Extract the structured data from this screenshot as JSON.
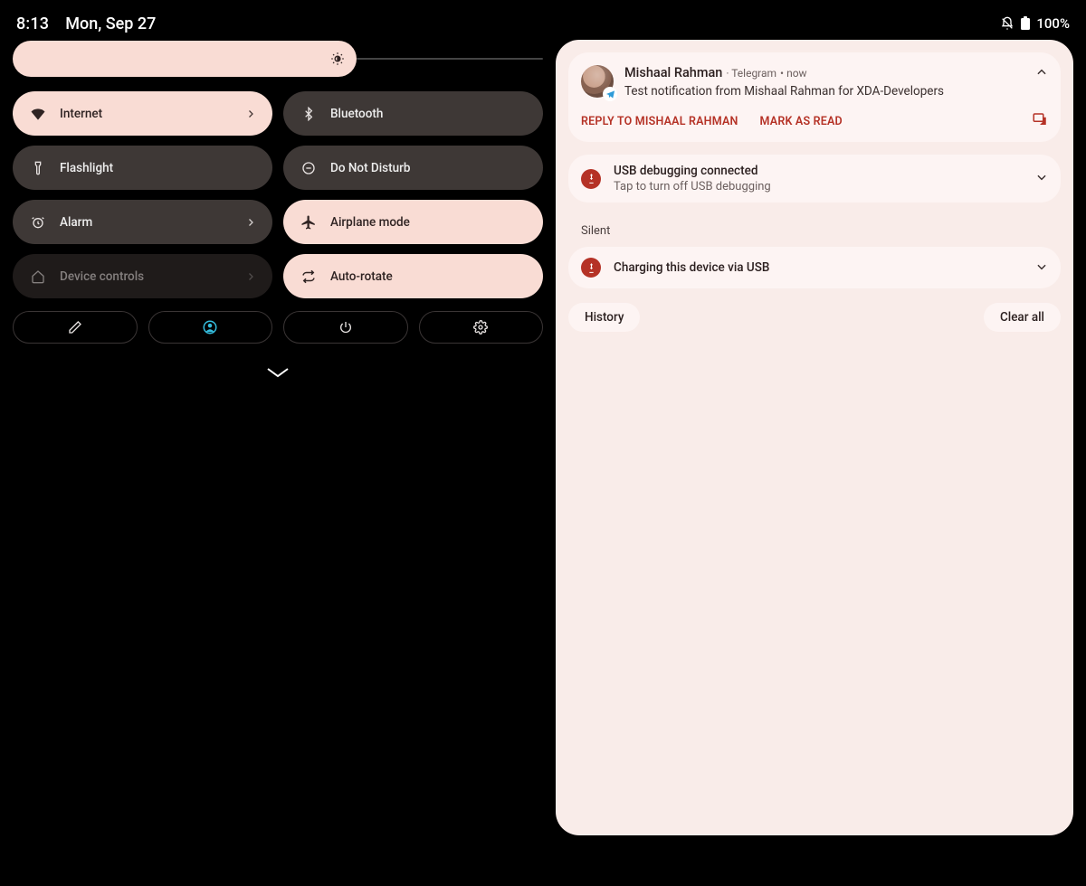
{
  "statusbar": {
    "time": "8:13",
    "date": "Mon, Sep 27",
    "battery": "100%"
  },
  "qs": {
    "brightness_percent": 64,
    "tiles": [
      {
        "label": "Internet",
        "icon": "wifi-icon",
        "on": true,
        "has_chevron": true
      },
      {
        "label": "Bluetooth",
        "icon": "bluetooth-icon",
        "on": false,
        "has_chevron": false
      },
      {
        "label": "Flashlight",
        "icon": "flashlight-icon",
        "on": false,
        "has_chevron": false
      },
      {
        "label": "Do Not Disturb",
        "icon": "dnd-icon",
        "on": false,
        "has_chevron": false
      },
      {
        "label": "Alarm",
        "icon": "alarm-icon",
        "on": false,
        "has_chevron": true
      },
      {
        "label": "Airplane mode",
        "icon": "airplane-icon",
        "on": true,
        "has_chevron": false
      },
      {
        "label": "Device controls",
        "icon": "home-icon",
        "disabled": true,
        "has_chevron": true
      },
      {
        "label": "Auto-rotate",
        "icon": "rotate-icon",
        "on": true,
        "has_chevron": false
      }
    ],
    "footer_buttons": [
      "edit-icon",
      "user-icon",
      "power-icon",
      "settings-gear-icon"
    ]
  },
  "notifications": {
    "conversation": {
      "sender": "Mishaal Rahman",
      "app": "Telegram",
      "time": "now",
      "body": "Test notification from Mishaal Rahman for XDA-Developers",
      "action1": "REPLY TO MISHAAL RAHMAN",
      "action2": "MARK AS READ"
    },
    "usb_debug": {
      "title": "USB debugging connected",
      "subtitle": "Tap to turn off USB debugging"
    },
    "silent_label": "Silent",
    "charging": {
      "title": "Charging this device via USB"
    },
    "history_label": "History",
    "clear_label": "Clear all"
  }
}
